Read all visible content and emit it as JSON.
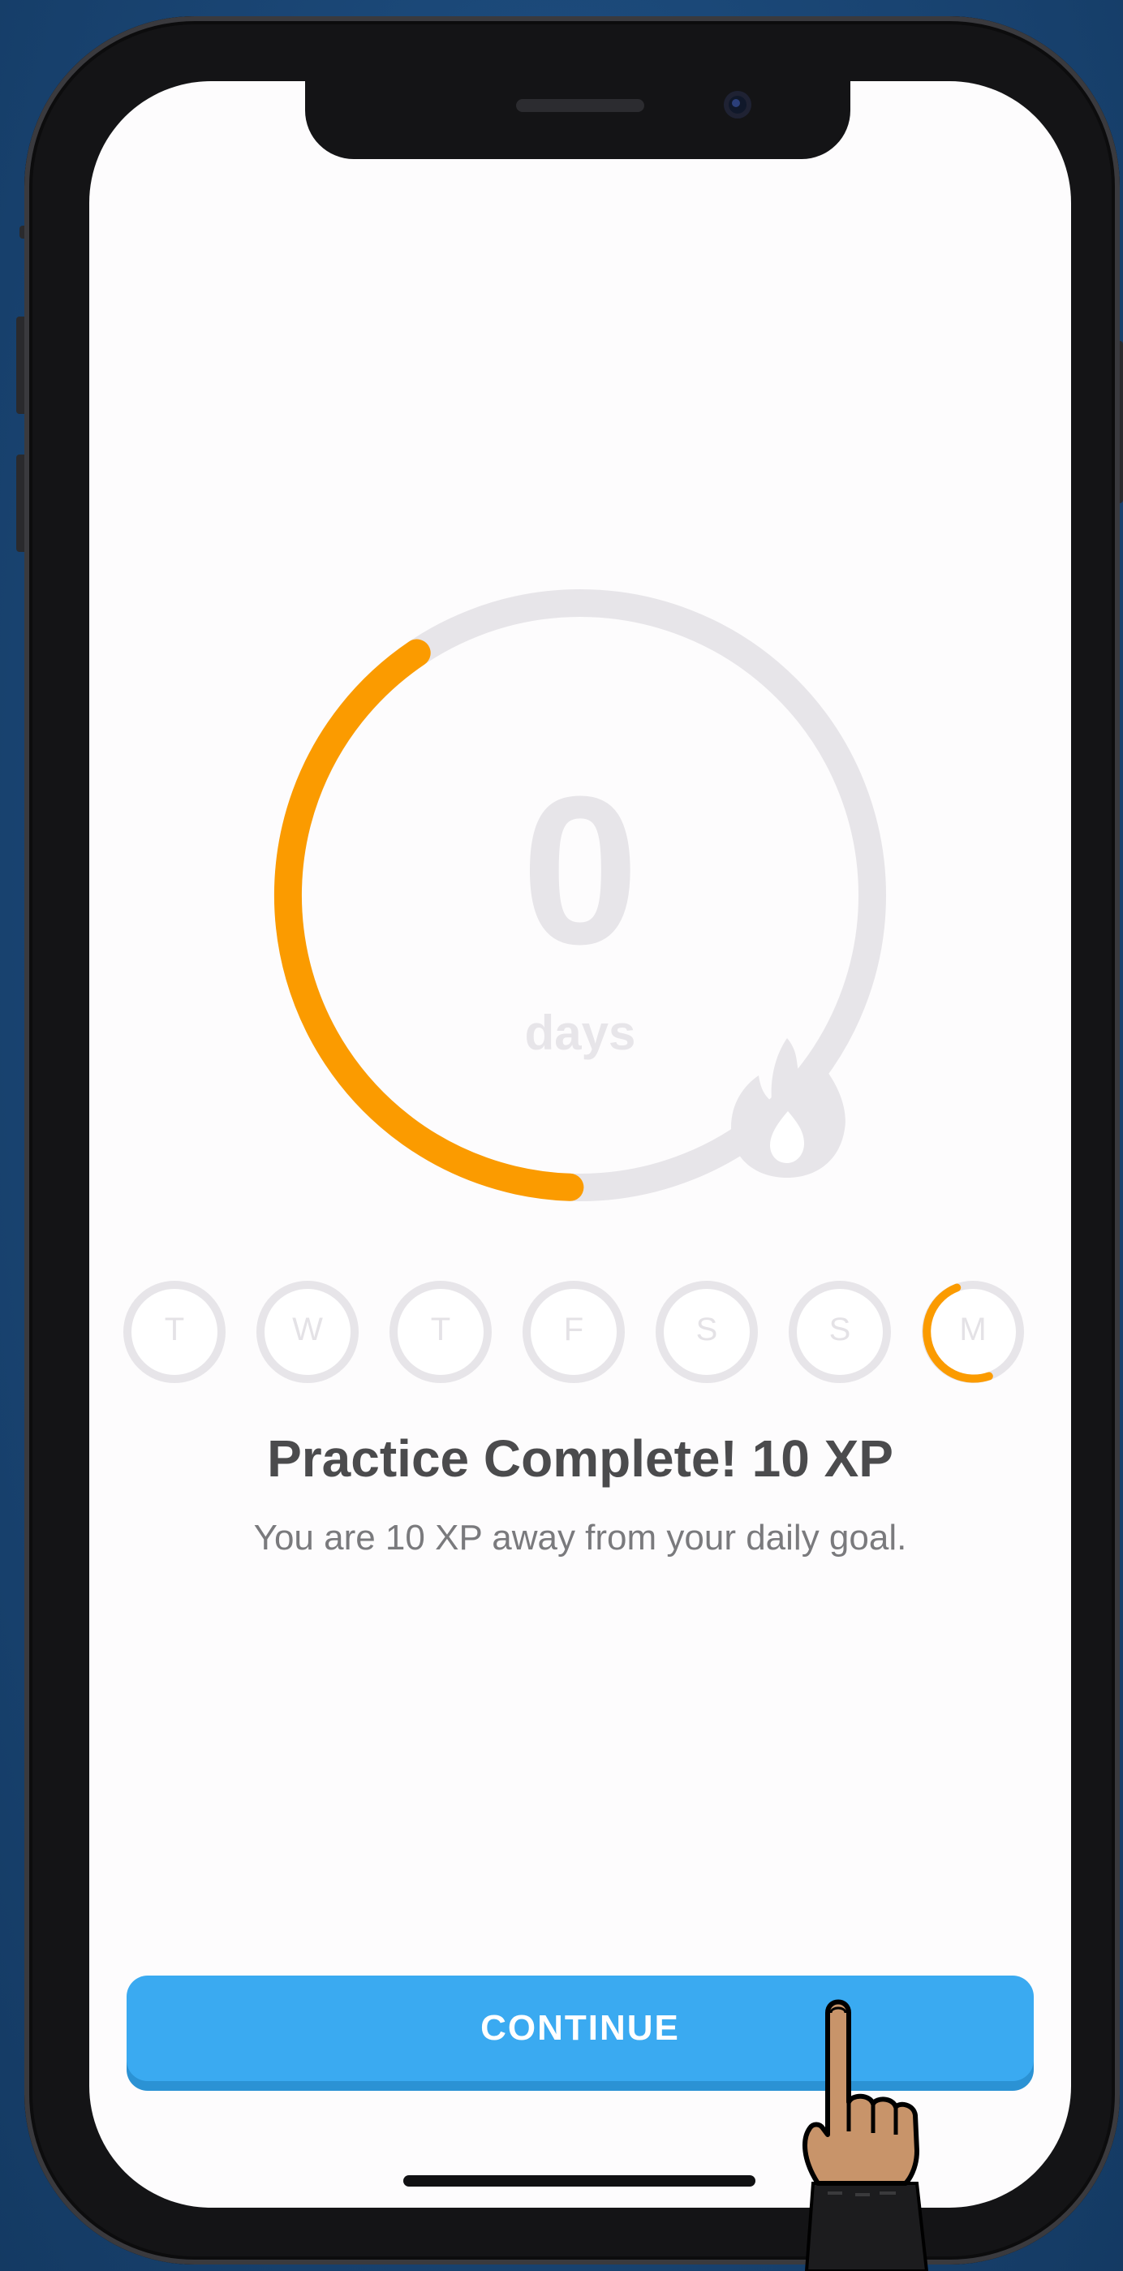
{
  "streak": {
    "count": "0",
    "unit": "days",
    "progress": 0.4
  },
  "week": {
    "days": [
      "T",
      "W",
      "T",
      "F",
      "S",
      "S",
      "M"
    ],
    "today_index": 6,
    "today_progress": 0.5
  },
  "result": {
    "title": "Practice Complete! 10 XP",
    "subtitle": "You are 10 XP away from your daily goal."
  },
  "actions": {
    "continue_label": "CONTINUE"
  },
  "colors": {
    "accent_orange": "#fb9b00",
    "ring_gray": "#e7e5e9",
    "button_blue": "#3aaaf1",
    "title_text": "#4b4b4d"
  },
  "icons": {
    "flame": "flame-icon",
    "pointer": "pointing-hand-icon"
  }
}
